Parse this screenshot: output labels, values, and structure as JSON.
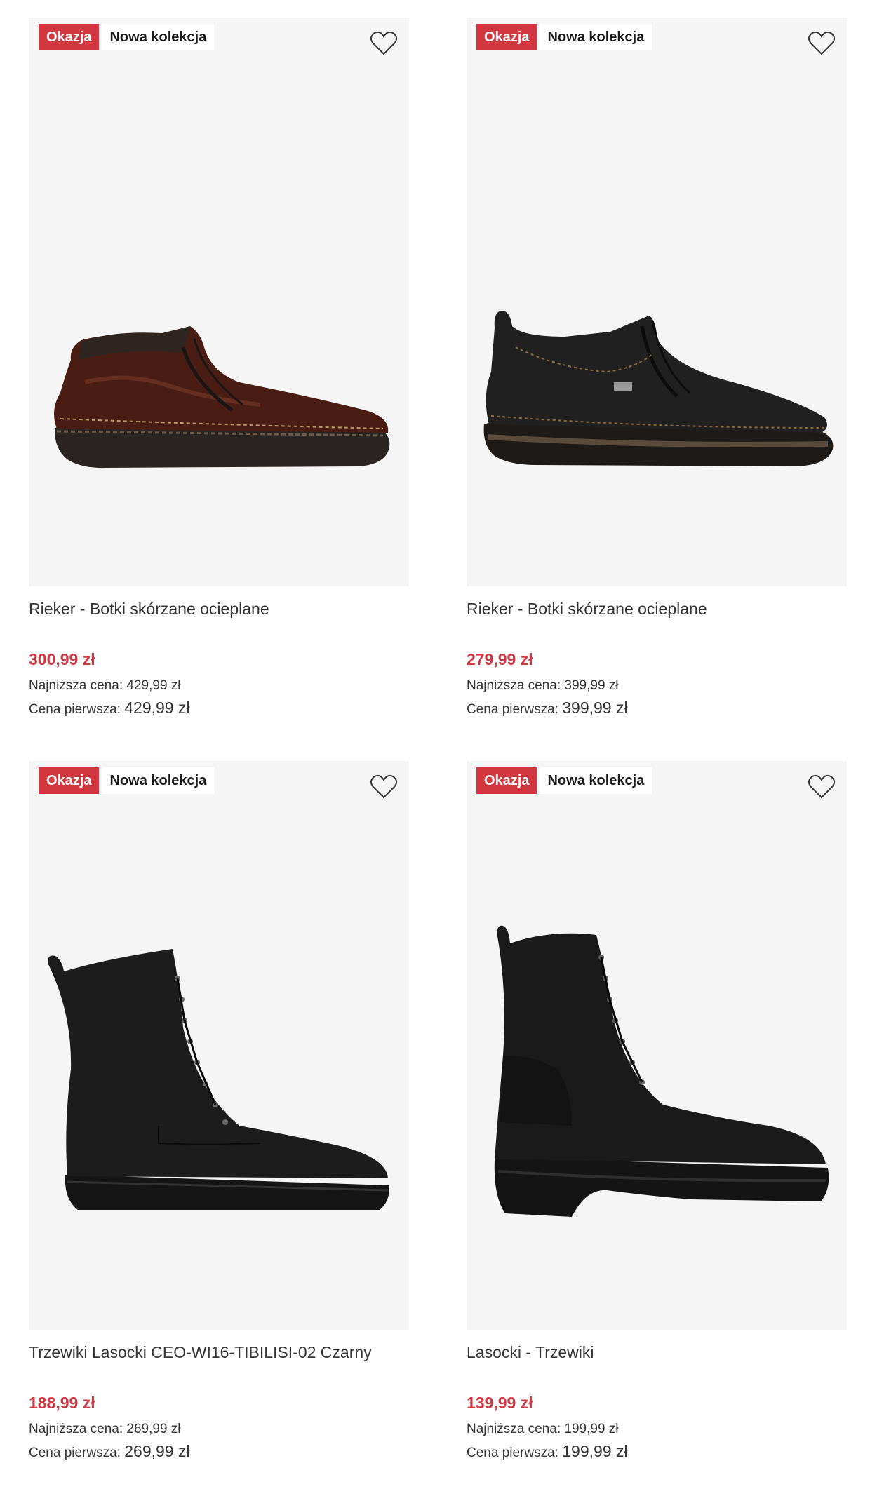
{
  "products": [
    {
      "badges": {
        "sale": "Okazja",
        "new": "Nowa kolekcja"
      },
      "title": "Rieker - Botki skórzane ocieplane",
      "price": "300,99 zł",
      "lowest_label": "Najniższa cena:",
      "lowest_value": "429,99 zł",
      "original_label": "Cena pierwsza:",
      "original_value": "429,99 zł",
      "image": "brown leather zip ankle boot"
    },
    {
      "badges": {
        "sale": "Okazja",
        "new": "Nowa kolekcja"
      },
      "title": "Rieker - Botki skórzane ocieplane",
      "price": "279,99 zł",
      "lowest_label": "Najniższa cena:",
      "lowest_value": "399,99 zł",
      "original_label": "Cena pierwsza:",
      "original_value": "399,99 zł",
      "image": "black leather zip ankle boot"
    },
    {
      "badges": {
        "sale": "Okazja",
        "new": "Nowa kolekcja"
      },
      "title": "Trzewiki Lasocki CEO-WI16-TIBILISI-02 Czarny",
      "price": "188,99 zł",
      "lowest_label": "Najniższa cena:",
      "lowest_value": "269,99 zł",
      "original_label": "Cena pierwsza:",
      "original_value": "269,99 zł",
      "image": "black lace-up boot"
    },
    {
      "badges": {
        "sale": "Okazja",
        "new": "Nowa kolekcja"
      },
      "title": "Lasocki - Trzewiki",
      "price": "139,99 zł",
      "lowest_label": "Najniższa cena:",
      "lowest_value": "199,99 zł",
      "original_label": "Cena pierwsza:",
      "original_value": "199,99 zł",
      "image": "black lace-up chunky boot"
    }
  ],
  "icons": {
    "favorite": "heart-outline-icon"
  },
  "colors": {
    "sale_red": "#d2363f",
    "image_bg": "#f5f5f5",
    "text": "#333333"
  }
}
